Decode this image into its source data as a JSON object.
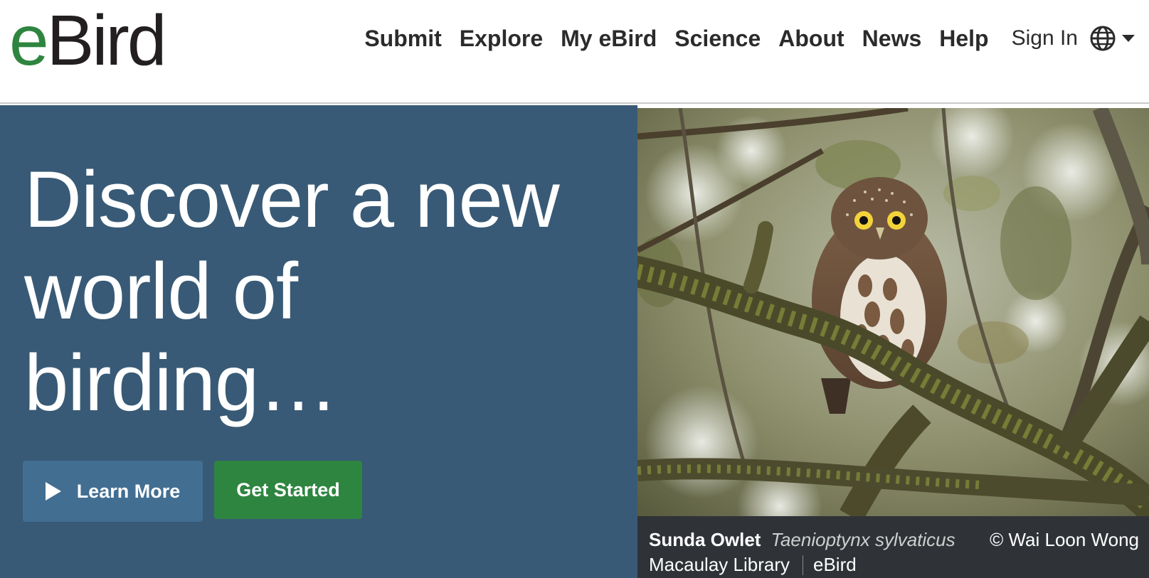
{
  "logo": {
    "e": "e",
    "rest": "Bird"
  },
  "nav": {
    "items": [
      "Submit",
      "Explore",
      "My eBird",
      "Science",
      "About",
      "News",
      "Help"
    ],
    "sign_in": "Sign In"
  },
  "icons": {
    "language": "globe-icon",
    "dropdown": "caret-down-icon",
    "learn_more": "play-icon"
  },
  "hero": {
    "title_lines": [
      "Discover a new",
      "world of",
      "birding…"
    ],
    "learn_more_label": "Learn More",
    "get_started_label": "Get Started"
  },
  "photo": {
    "common_name": "Sunda Owlet",
    "scientific_name": "Taenioptynx sylvaticus",
    "credit": "© Wai Loon Wong",
    "source": "Macaulay Library",
    "source_site": "eBird"
  },
  "colors": {
    "brand_green": "#2e8540",
    "hero_blue": "#385a76",
    "button_blue": "#426e92",
    "caption_bg": "#2f3337"
  }
}
